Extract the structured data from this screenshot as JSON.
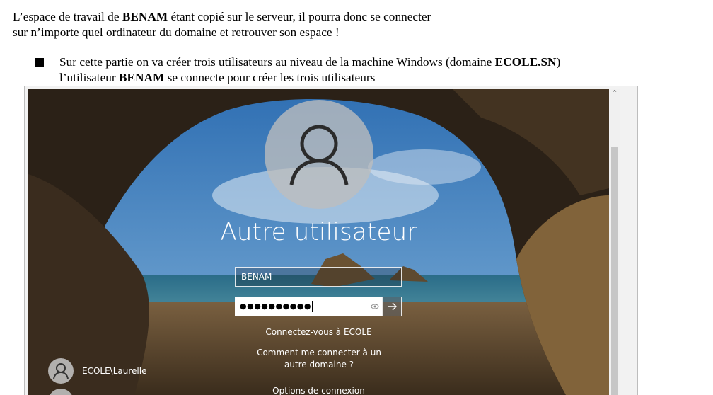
{
  "document": {
    "line1_pre": "L’espace de travail de ",
    "line1_bold": "BENAM",
    "line1_post": " étant copié sur le serveur, il pourra donc se connecter",
    "line2": "sur n’importe quel ordinateur du domaine et retrouver son espace !",
    "bullet_a": "Sur cette partie on va créer trois utilisateurs au niveau de la machine Windows  (domaine ",
    "bullet_a_bold": "ECOLE.SN",
    "bullet_a_end": ")",
    "bullet_b_pre": "l’utilisateur ",
    "bullet_b_bold": "BENAM",
    "bullet_b_post": " se connecte pour créer les trois utilisateurs"
  },
  "login": {
    "title": "Autre utilisateur",
    "username_value": "BENAM",
    "password_masked": "●●●●●●●●●●",
    "connect_domain_text": "Connectez-vous à ECOLE",
    "other_domain_text": "Comment me connecter à un autre domaine ?",
    "signin_options_text": "Options de connexion",
    "users": [
      {
        "label": "ECOLE\\Laurelle"
      }
    ]
  },
  "colors": {
    "sky": "#3a78b8",
    "sea": "#2c6a86",
    "sand": "#a07a4a",
    "rock": "#2a2018"
  },
  "icons": [
    "user-avatar-icon",
    "eye-reveal-icon",
    "arrow-right-icon",
    "scroll-up-icon"
  ]
}
